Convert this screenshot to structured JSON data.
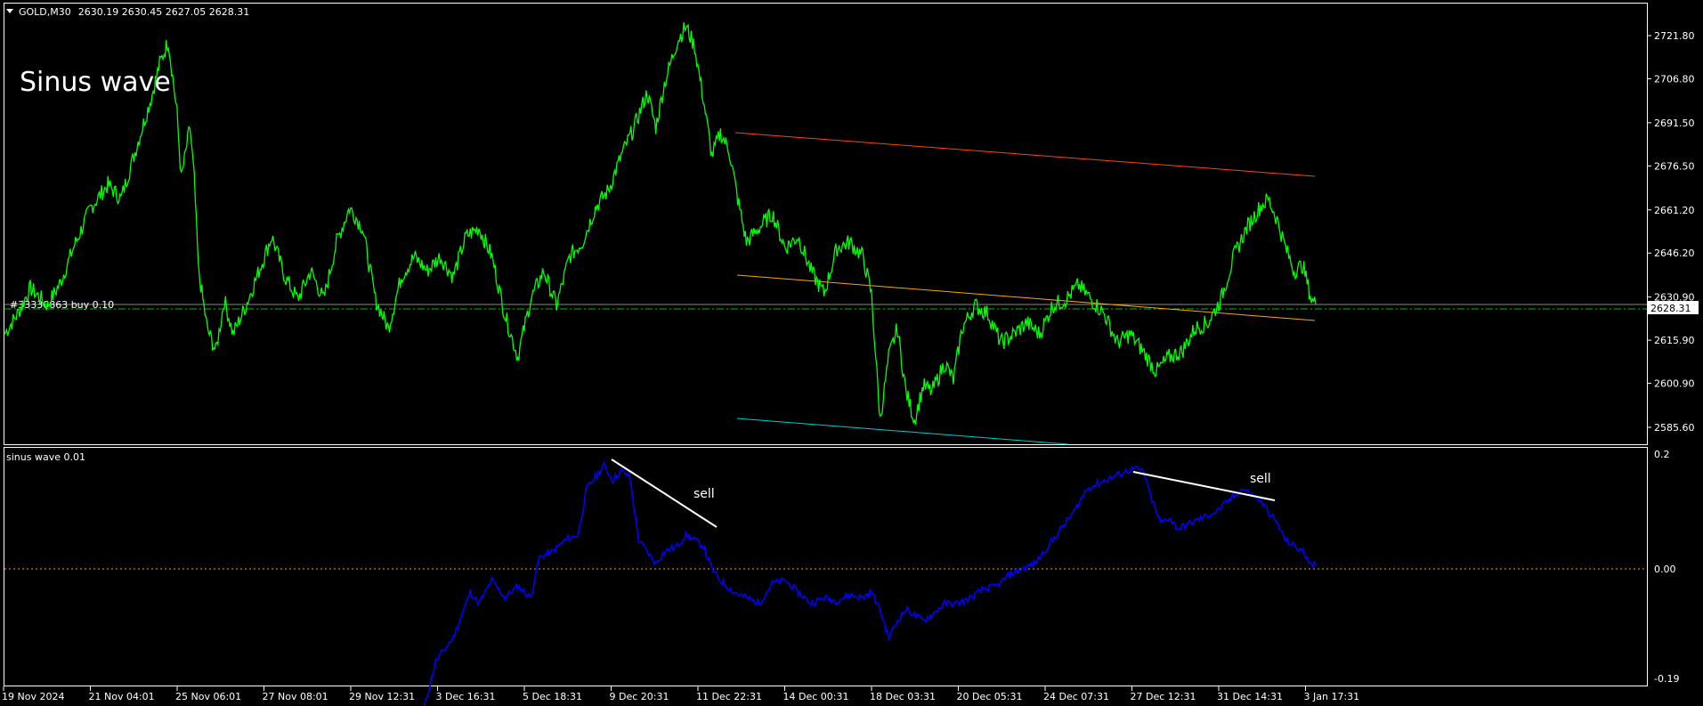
{
  "header": {
    "symbol": "GOLD,M30",
    "ohlc": "2630.19 2630.45 2627.05 2628.31"
  },
  "annotation_title": "Sinus wave",
  "order_line_label": "#33330863 buy 0.10",
  "price_tag": "2628.31",
  "indicator": {
    "label": "sinus wave 0.01",
    "sell_labels": [
      "sell",
      "sell"
    ]
  },
  "colors": {
    "background": "#000000",
    "price_line": "#00ff00",
    "indicator_line": "#0000ff",
    "upper_channel": "#ff4500",
    "middle_channel": "#ffa500",
    "lower_channel": "#00ced1",
    "divergence_line": "#ffffff",
    "zero_line": "#ffa500",
    "order_line": "#00c000"
  },
  "chart_data": [
    {
      "type": "line",
      "series": [
        {
          "values": []
        }
      ],
      "y_ticks": [
        "2721.80",
        "2706.80",
        "2691.50",
        "2676.50",
        "2661.20",
        "2646.20",
        "2630.90",
        "2615.90",
        "2600.90",
        "2585.60"
      ],
      "ylim": [
        2580,
        2735
      ],
      "x_tick_labels": [
        "19 Nov 2024",
        "21 Nov 04:01",
        "25 Nov 06:01",
        "27 Nov 08:01",
        "29 Nov 12:31",
        "3 Dec 16:31",
        "5 Dec 18:31",
        "9 Dec 20:31",
        "11 Dec 22:31",
        "14 Dec 00:31",
        "18 Dec 03:31",
        "20 Dec 05:31",
        "24 Dec 07:31",
        "27 Dec 12:31",
        "31 Dec 14:31",
        "3 Jan 17:31"
      ],
      "keypoints": [
        [
          0,
          2618
        ],
        [
          3,
          2625
        ],
        [
          6,
          2634
        ],
        [
          10,
          2628
        ],
        [
          13,
          2636
        ],
        [
          16,
          2648
        ],
        [
          20,
          2662
        ],
        [
          24,
          2670
        ],
        [
          27,
          2665
        ],
        [
          31,
          2685
        ],
        [
          34,
          2700
        ],
        [
          36,
          2712
        ],
        [
          38,
          2720
        ],
        [
          40,
          2695
        ],
        [
          41,
          2672
        ],
        [
          43,
          2690
        ],
        [
          44,
          2672
        ],
        [
          45,
          2640
        ],
        [
          47,
          2620
        ],
        [
          49,
          2612
        ],
        [
          51,
          2630
        ],
        [
          53,
          2618
        ],
        [
          56,
          2628
        ],
        [
          59,
          2640
        ],
        [
          62,
          2652
        ],
        [
          65,
          2638
        ],
        [
          68,
          2630
        ],
        [
          71,
          2640
        ],
        [
          74,
          2630
        ],
        [
          77,
          2650
        ],
        [
          80,
          2662
        ],
        [
          83,
          2655
        ],
        [
          86,
          2630
        ],
        [
          89,
          2620
        ],
        [
          92,
          2638
        ],
        [
          95,
          2645
        ],
        [
          98,
          2640
        ],
        [
          101,
          2645
        ],
        [
          104,
          2638
        ],
        [
          107,
          2652
        ],
        [
          110,
          2655
        ],
        [
          113,
          2645
        ],
        [
          116,
          2625
        ],
        [
          119,
          2610
        ],
        [
          122,
          2630
        ],
        [
          125,
          2640
        ],
        [
          128,
          2628
        ],
        [
          131,
          2645
        ],
        [
          134,
          2650
        ],
        [
          137,
          2662
        ],
        [
          140,
          2668
        ],
        [
          143,
          2680
        ],
        [
          146,
          2690
        ],
        [
          149,
          2702
        ],
        [
          151,
          2690
        ],
        [
          153,
          2705
        ],
        [
          156,
          2720
        ],
        [
          158,
          2725
        ],
        [
          160,
          2718
        ],
        [
          162,
          2700
        ],
        [
          164,
          2680
        ],
        [
          166,
          2688
        ],
        [
          168,
          2682
        ],
        [
          170,
          2665
        ],
        [
          172,
          2650
        ],
        [
          175,
          2655
        ],
        [
          178,
          2660
        ],
        [
          181,
          2648
        ],
        [
          184,
          2652
        ],
        [
          187,
          2640
        ],
        [
          190,
          2632
        ],
        [
          193,
          2648
        ],
        [
          196,
          2650
        ],
        [
          199,
          2645
        ],
        [
          201,
          2632
        ],
        [
          202,
          2610
        ],
        [
          203,
          2588
        ],
        [
          205,
          2610
        ],
        [
          207,
          2620
        ],
        [
          209,
          2598
        ],
        [
          211,
          2588
        ],
        [
          213,
          2600
        ],
        [
          215,
          2598
        ],
        [
          218,
          2608
        ],
        [
          220,
          2602
        ],
        [
          222,
          2620
        ],
        [
          225,
          2628
        ],
        [
          228,
          2625
        ],
        [
          231,
          2615
        ],
        [
          234,
          2618
        ],
        [
          237,
          2622
        ],
        [
          240,
          2618
        ],
        [
          243,
          2628
        ],
        [
          246,
          2630
        ],
        [
          249,
          2635
        ],
        [
          252,
          2630
        ],
        [
          255,
          2625
        ],
        [
          258,
          2615
        ],
        [
          261,
          2618
        ],
        [
          264,
          2612
        ],
        [
          267,
          2605
        ],
        [
          270,
          2610
        ],
        [
          273,
          2612
        ],
        [
          276,
          2620
        ],
        [
          279,
          2622
        ],
        [
          282,
          2630
        ],
        [
          285,
          2645
        ],
        [
          288,
          2655
        ],
        [
          291,
          2662
        ],
        [
          293,
          2665
        ],
        [
          295,
          2658
        ],
        [
          297,
          2648
        ],
        [
          299,
          2640
        ],
        [
          301,
          2642
        ],
        [
          303,
          2630
        ],
        [
          304,
          2628.31
        ]
      ]
    },
    {
      "type": "line",
      "series": [
        {
          "values": []
        }
      ],
      "y_ticks": [
        "0.2",
        "0.00",
        "-0.19"
      ],
      "ylim": [
        -0.19,
        0.2
      ],
      "keypoints": [
        [
          97,
          -0.25
        ],
        [
          100,
          -0.16
        ],
        [
          104,
          -0.12
        ],
        [
          108,
          -0.04
        ],
        [
          110,
          -0.06
        ],
        [
          113,
          -0.02
        ],
        [
          116,
          -0.05
        ],
        [
          119,
          -0.03
        ],
        [
          122,
          -0.05
        ],
        [
          124,
          0.02
        ],
        [
          127,
          0.03
        ],
        [
          130,
          0.05
        ],
        [
          133,
          0.06
        ],
        [
          135,
          0.14
        ],
        [
          137,
          0.16
        ],
        [
          139,
          0.18
        ],
        [
          141,
          0.155
        ],
        [
          143,
          0.17
        ],
        [
          145,
          0.16
        ],
        [
          147,
          0.05
        ],
        [
          149,
          0.03
        ],
        [
          151,
          0.01
        ],
        [
          153,
          0.03
        ],
        [
          156,
          0.04
        ],
        [
          158,
          0.06
        ],
        [
          160,
          0.05
        ],
        [
          162,
          0.04
        ],
        [
          164,
          0.0
        ],
        [
          166,
          -0.02
        ],
        [
          169,
          -0.04
        ],
        [
          172,
          -0.05
        ],
        [
          175,
          -0.06
        ],
        [
          178,
          -0.025
        ],
        [
          181,
          -0.02
        ],
        [
          184,
          -0.04
        ],
        [
          187,
          -0.06
        ],
        [
          190,
          -0.05
        ],
        [
          193,
          -0.055
        ],
        [
          196,
          -0.045
        ],
        [
          199,
          -0.05
        ],
        [
          201,
          -0.04
        ],
        [
          203,
          -0.07
        ],
        [
          205,
          -0.12
        ],
        [
          207,
          -0.09
        ],
        [
          209,
          -0.07
        ],
        [
          211,
          -0.08
        ],
        [
          213,
          -0.09
        ],
        [
          215,
          -0.08
        ],
        [
          218,
          -0.06
        ],
        [
          221,
          -0.06
        ],
        [
          224,
          -0.05
        ],
        [
          227,
          -0.035
        ],
        [
          230,
          -0.03
        ],
        [
          233,
          -0.01
        ],
        [
          236,
          0.0
        ],
        [
          239,
          0.01
        ],
        [
          242,
          0.04
        ],
        [
          245,
          0.07
        ],
        [
          248,
          0.1
        ],
        [
          251,
          0.14
        ],
        [
          254,
          0.15
        ],
        [
          257,
          0.16
        ],
        [
          260,
          0.17
        ],
        [
          262,
          0.175
        ],
        [
          264,
          0.17
        ],
        [
          266,
          0.12
        ],
        [
          268,
          0.08
        ],
        [
          270,
          0.09
        ],
        [
          272,
          0.07
        ],
        [
          275,
          0.08
        ],
        [
          278,
          0.09
        ],
        [
          281,
          0.1
        ],
        [
          284,
          0.12
        ],
        [
          287,
          0.14
        ],
        [
          289,
          0.13
        ],
        [
          291,
          0.12
        ],
        [
          293,
          0.1
        ],
        [
          295,
          0.08
        ],
        [
          297,
          0.05
        ],
        [
          299,
          0.04
        ],
        [
          301,
          0.03
        ],
        [
          303,
          0.01
        ],
        [
          304,
          0.005
        ]
      ]
    }
  ]
}
